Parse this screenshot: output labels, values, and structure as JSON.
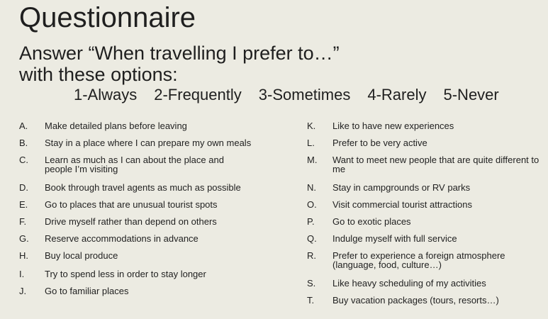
{
  "title": "Questionnaire",
  "subtitle_line1": "Answer “When travelling I prefer to…”",
  "subtitle_line2": "with these options:",
  "options": [
    "1-Always",
    "2-Frequently",
    "3-Sometimes",
    "4-Rarely",
    "5-Never"
  ],
  "left_items": [
    {
      "letter": "A.",
      "text": "Make detailed plans before leaving"
    },
    {
      "letter": "B.",
      "text": "Stay in a place where I can prepare my own meals"
    },
    {
      "letter": "C.",
      "text": "Learn as much as I can about the place and people I’m visiting"
    },
    {
      "letter": "D.",
      "text": "Book through travel agents as much as possible"
    },
    {
      "letter": "E.",
      "text": "Go to places that are unusual tourist spots"
    },
    {
      "letter": "F.",
      "text": "Drive myself rather than depend on others"
    },
    {
      "letter": "G.",
      "text": "Reserve accommodations in advance"
    },
    {
      "letter": "H.",
      "text": "Buy local produce"
    },
    {
      "letter": "I.",
      "text": "Try to spend less in order to stay longer"
    },
    {
      "letter": "J.",
      "text": "Go to familiar places"
    }
  ],
  "right_items": [
    {
      "letter": "K.",
      "text": "Like to have new experiences"
    },
    {
      "letter": "L.",
      "text": "Prefer to be very active"
    },
    {
      "letter": "M.",
      "text": "Want to meet new people that are quite different to me"
    },
    {
      "letter": "N.",
      "text": "Stay in campgrounds or RV parks"
    },
    {
      "letter": "O.",
      "text": "Visit commercial tourist attractions"
    },
    {
      "letter": "P.",
      "text": "Go to exotic places"
    },
    {
      "letter": "Q.",
      "text": "Indulge myself with full service"
    },
    {
      "letter": "R.",
      "text": "Prefer to experience a foreign atmosphere (language, food, culture…)"
    },
    {
      "letter": "S.",
      "text": "Like heavy scheduling of my activities"
    },
    {
      "letter": "T.",
      "text": "Buy vacation packages (tours, resorts…)"
    }
  ]
}
